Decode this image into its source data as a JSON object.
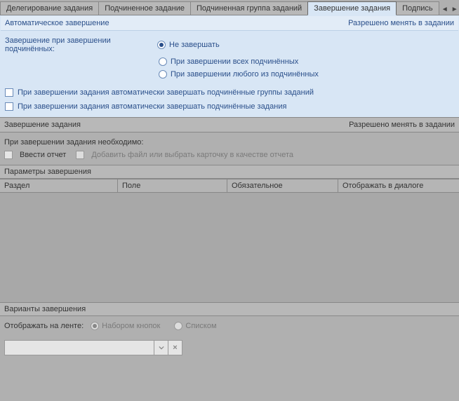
{
  "tabs": {
    "t0": "Делегирование задания",
    "t1": "Подчиненное задание",
    "t2": "Подчиненная группа заданий",
    "t3": "Завершение задания",
    "t4": "Подпись"
  },
  "auto": {
    "title": "Автоматическое завершение",
    "right": "Разрешено менять в задании",
    "radio_label": "Завершение при завершении подчинённых:",
    "opt1": "Не завершать",
    "opt2": "При завершении всех подчинённых",
    "opt3": "При завершении любого из подчинённых",
    "chk1": "При завершении задания автоматически завершать подчинённые группы заданий",
    "chk2": "При завершении задания автоматически завершать подчинённые задания"
  },
  "finish": {
    "title": "Завершение задания",
    "right": "Разрешено менять в задании",
    "req_label": "При завершении задания необходимо:",
    "chk_report": "Ввести отчет",
    "chk_addfile": "Добавить файл или выбрать карточку в качестве отчета"
  },
  "params": {
    "title": "Параметры завершения",
    "col1": "Раздел",
    "col2": "Поле",
    "col3": "Обязательное",
    "col4": "Отображать в диалоге"
  },
  "variants": {
    "title": "Варианты завершения",
    "show_label": "Отображать на ленте:",
    "opt_buttons": "Набором кнопок",
    "opt_list": "Списком",
    "clear_glyph": "×"
  }
}
